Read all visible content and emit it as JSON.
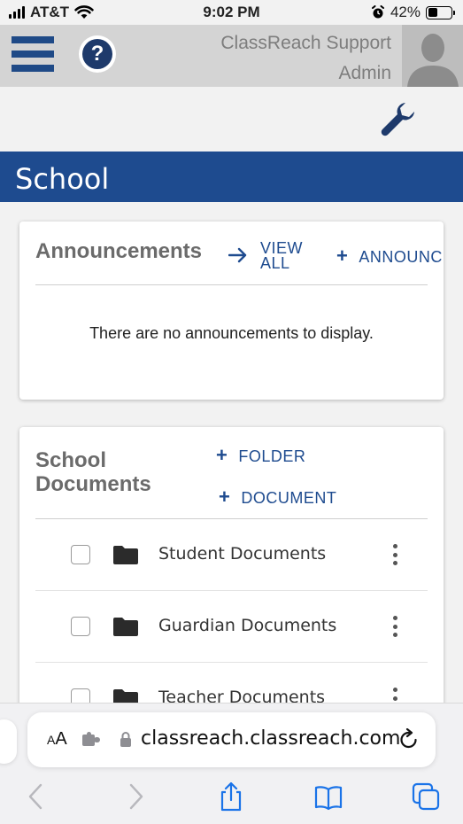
{
  "status_bar": {
    "carrier": "AT&T",
    "time": "9:02 PM",
    "battery_percent": "42%",
    "battery_level": 0.42,
    "icons": [
      "signal-icon",
      "wifi-icon",
      "alarm-icon",
      "battery-icon"
    ]
  },
  "header": {
    "user_name": "ClassReach Support",
    "user_role": "Admin",
    "brand_color": "#1e4b8f",
    "icons": [
      "menu-icon",
      "help-icon",
      "avatar-icon",
      "wrench-icon"
    ]
  },
  "page": {
    "title": "School"
  },
  "announcements": {
    "title": "Announcements",
    "view_all_label": "VIEW ALL",
    "add_label": "ANNOUNCEMENT",
    "empty_message": "There are no announcements to display."
  },
  "documents": {
    "title": "School Documents",
    "add_folder_label": "FOLDER",
    "add_document_label": "DOCUMENT",
    "items": [
      {
        "name": "Student Documents",
        "type": "folder"
      },
      {
        "name": "Guardian Documents",
        "type": "folder"
      },
      {
        "name": "Teacher Documents",
        "type": "folder"
      }
    ]
  },
  "browser": {
    "text_size_label": "AA",
    "url": "classreach.classreach.com",
    "icons": [
      "extension-icon",
      "lock-icon",
      "reload-icon",
      "back-icon",
      "forward-icon",
      "share-icon",
      "bookmarks-icon",
      "tabs-icon"
    ]
  }
}
